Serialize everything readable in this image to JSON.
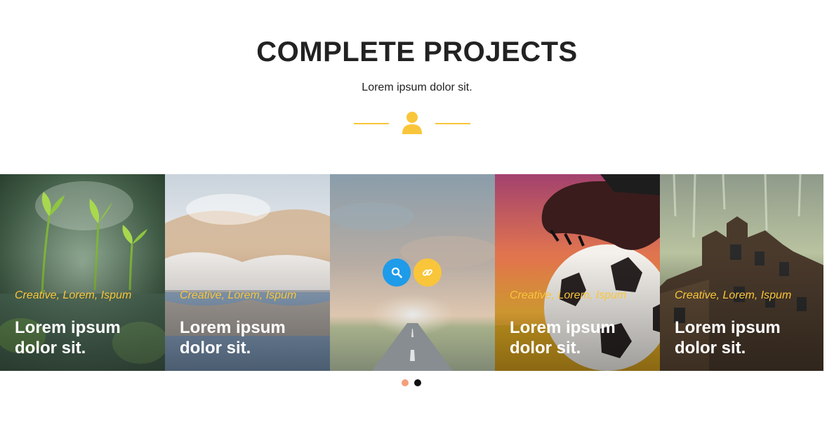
{
  "section": {
    "title": "COMPLETE PROJECTS",
    "subtitle": "Lorem ipsum dolor sit."
  },
  "colors": {
    "accent": "#f9c53a",
    "search_button": "#1e9be9",
    "dot_inactive": "#f4a07a",
    "dot_active": "#111111"
  },
  "projects": [
    {
      "image": "sprouts-in-rain",
      "categories": "Creative, Lorem, Ispum",
      "caption": "Lorem ipsum dolor sit."
    },
    {
      "image": "frosty-winter-lake",
      "categories": "Creative, Lorem, Ispum",
      "caption": "Lorem ipsum dolor sit."
    },
    {
      "image": "road-at-sunset",
      "categories": "",
      "caption": "",
      "actions": [
        "search-icon",
        "link-icon"
      ]
    },
    {
      "image": "soccer-ball-under-boot",
      "categories": "Creative, Lorem, Ispum",
      "caption": "Lorem ipsum dolor sit."
    },
    {
      "image": "old-castle-in-rain",
      "categories": "Creative, Lorem, Ispum",
      "caption": "Lorem ipsum dolor sit."
    }
  ],
  "pagination": {
    "pages": 2,
    "current": 2
  }
}
